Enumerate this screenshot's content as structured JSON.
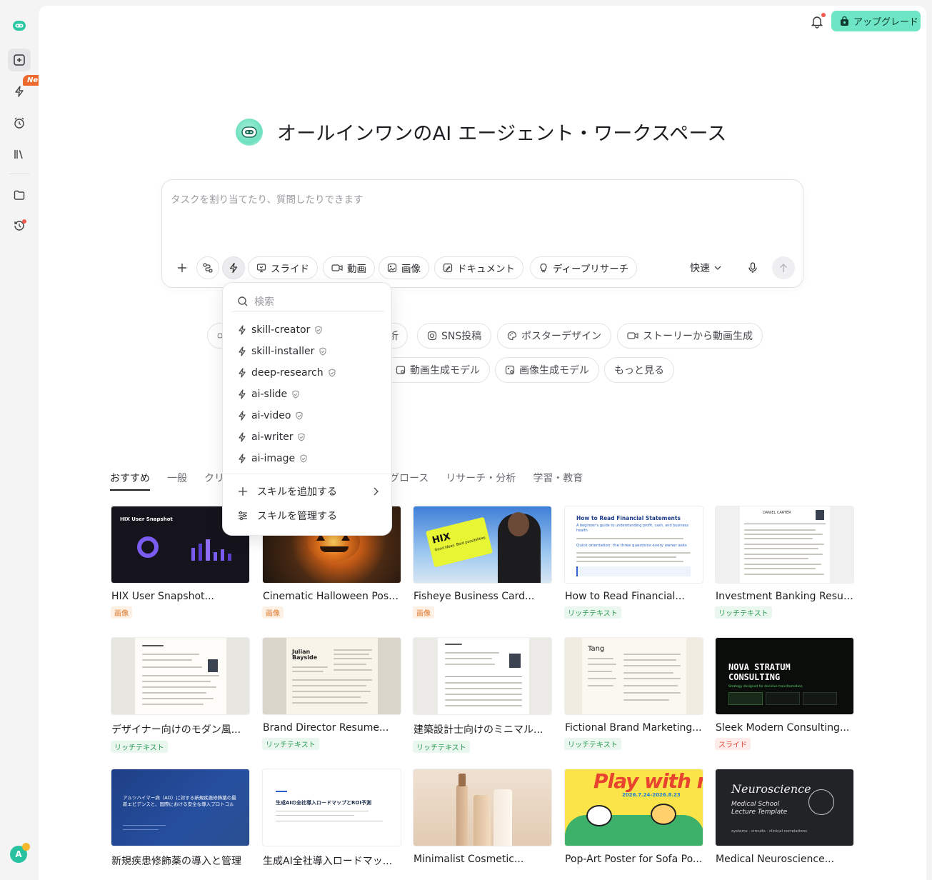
{
  "topbar": {
    "upgrade_label": "アップグレード"
  },
  "sidebar": {
    "new_badge": "New",
    "avatar_letter": "A"
  },
  "hero": {
    "title": "オールインワンのAI エージェント・ワークスペース"
  },
  "composer": {
    "placeholder": "タスクを割り当てたり、質問したりできます",
    "chips": [
      "スライド",
      "動画",
      "画像",
      "ドキュメント",
      "ディープリサーチ"
    ],
    "speed": "快速"
  },
  "suggestions": {
    "row1": [
      "析",
      "SNS投稿",
      "ポスターデザイン",
      "ストーリーから動画生成"
    ],
    "row2": [
      "動画生成モデル",
      "画像生成モデル",
      "もっと見る"
    ]
  },
  "skills_menu": {
    "search_placeholder": "検索",
    "skills": [
      "skill-creator",
      "skill-installer",
      "deep-research",
      "ai-slide",
      "ai-video",
      "ai-writer",
      "ai-image"
    ],
    "add_label": "スキルを追加する",
    "manage_label": "スキルを管理する"
  },
  "tabs": [
    "おすすめ",
    "一般",
    "クリ",
    "ング・グロース",
    "リサーチ・分析",
    "学習・教育"
  ],
  "templates": [
    {
      "title": "HIX User Snapshot...",
      "tag": "画像"
    },
    {
      "title": "Cinematic Halloween Poste...",
      "tag": "画像"
    },
    {
      "title": "Fisheye Business Card...",
      "tag": "画像"
    },
    {
      "title": "How to Read Financial...",
      "tag": "リッチテキスト"
    },
    {
      "title": "Investment Banking Resum...",
      "tag": "リッチテキスト"
    },
    {
      "title": "デザイナー向けのモダン風...",
      "tag": "リッチテキスト"
    },
    {
      "title": "Brand Director Resume...",
      "tag": "リッチテキスト"
    },
    {
      "title": "建築設計士向けのミニマル...",
      "tag": "リッチテキスト"
    },
    {
      "title": "Fictional Brand Marketing...",
      "tag": "リッチテキスト"
    },
    {
      "title": "Sleek Modern Consulting...",
      "tag": "スライド"
    },
    {
      "title": "新規疾患修飾薬の導入と管理"
    },
    {
      "title": "生成AI全社導入ロードマッ..."
    },
    {
      "title": "Minimalist Cosmetic..."
    },
    {
      "title": "Pop-Art Poster for Sofa Po..."
    },
    {
      "title": "Medical Neuroscience..."
    }
  ],
  "thumb_text": {
    "hix_snapshot": "HIX User Snapshot",
    "hix_card": "HIX",
    "hix_card_sub": "Good ideas. Bold possibilities",
    "fin_title": "How to Read Financial Statements",
    "fin_sub": "A beginner's guide to understanding profit, cash, and business health",
    "fin_h2": "Quick orientation: the three questions every owner asks",
    "resume_name": "DANIEL CARTER",
    "brand_name": "Julian Bayside",
    "brand_tang": "Tang",
    "nova": "NOVA STRATUM CONSULTING",
    "nova_sub": "Strategy designed for decisive transformation",
    "alz": "アルツハイマー病（AD）に対する新規疾患修飾薬の最新エビデンスと、国際における安全な導入プロトコル",
    "genai": "生成AIの全社導入ロードマップとROI予測",
    "play": "Play with me!",
    "play_dates": "2026.7.24-2026.8.23",
    "neuro": "Neuroscience",
    "neuro_sub": "Medical School Lecture Template",
    "neuro_foot": "systems · circuits · clinical correlations"
  },
  "colors": {
    "accent": "#6ee5c4",
    "badge": "#ee6a2e",
    "notify": "#f25a4f"
  }
}
